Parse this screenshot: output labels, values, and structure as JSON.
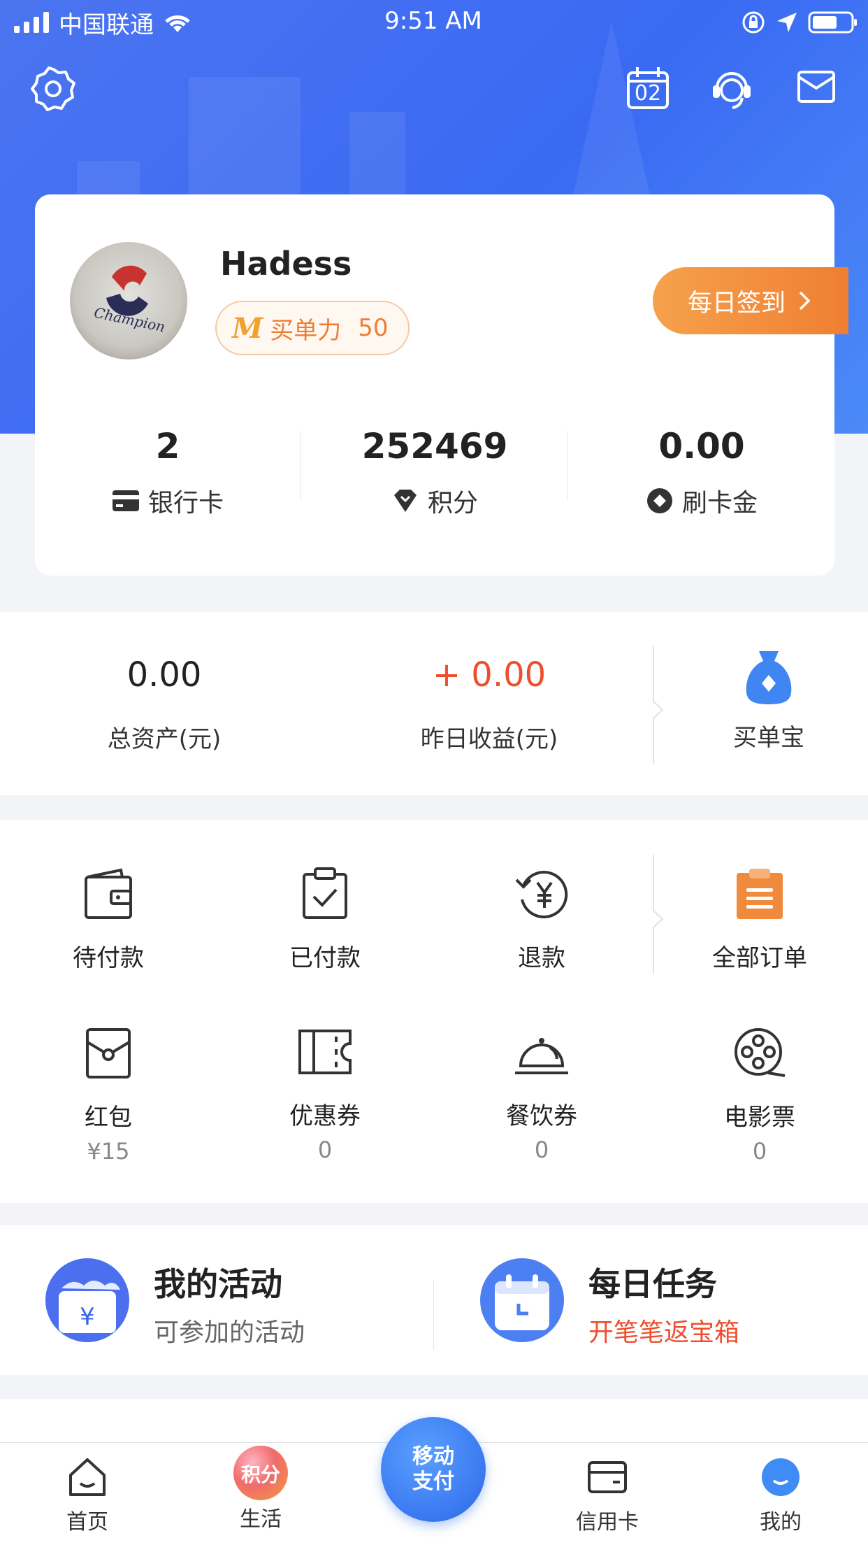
{
  "status_bar": {
    "carrier": "中国联通",
    "time": "9:51 AM"
  },
  "header": {
    "calendar_day": "02"
  },
  "profile": {
    "username": "Hadess",
    "vip_label": "买单力",
    "vip_value": "50",
    "checkin_label": "每日签到",
    "stats": [
      {
        "value": "2",
        "label": "银行卡",
        "icon": "bank-card-icon"
      },
      {
        "value": "252469",
        "label": "积分",
        "icon": "diamond-icon"
      },
      {
        "value": "0.00",
        "label": "刷卡金",
        "icon": "coin-icon"
      }
    ]
  },
  "assets": {
    "total_value": "0.00",
    "total_label": "总资产(元)",
    "yesterday_value": "+ 0.00",
    "yesterday_label": "昨日收益(元)",
    "wallet_label": "买单宝"
  },
  "orders": {
    "row1": [
      {
        "label": "待付款",
        "icon": "wallet-icon"
      },
      {
        "label": "已付款",
        "icon": "clipboard-check-icon"
      },
      {
        "label": "退款",
        "icon": "refund-icon"
      },
      {
        "label": "全部订单",
        "icon": "orders-icon"
      }
    ],
    "row2": [
      {
        "label": "红包",
        "sub": "¥15",
        "icon": "red-envelope-icon"
      },
      {
        "label": "优惠券",
        "sub": "0",
        "icon": "coupon-icon"
      },
      {
        "label": "餐饮券",
        "sub": "0",
        "icon": "dining-icon"
      },
      {
        "label": "电影票",
        "sub": "0",
        "icon": "film-reel-icon"
      }
    ]
  },
  "activities": {
    "mine_title": "我的活动",
    "mine_sub": "可参加的活动",
    "task_title": "每日任务",
    "task_sub": "开笔笔返宝箱"
  },
  "tabbar": {
    "items": [
      {
        "label": "首页",
        "icon": "home-icon"
      },
      {
        "label": "生活",
        "icon": "points-icon",
        "badge": "积分"
      },
      {
        "label": "信用卡",
        "icon": "credit-card-icon"
      },
      {
        "label": "我的",
        "icon": "profile-icon"
      }
    ],
    "pay_line1": "移动",
    "pay_line2": "支付"
  },
  "colors": {
    "brand_blue": "#3a6af3",
    "accent_orange": "#ef7f32",
    "accent_red": "#ef4e2e"
  }
}
